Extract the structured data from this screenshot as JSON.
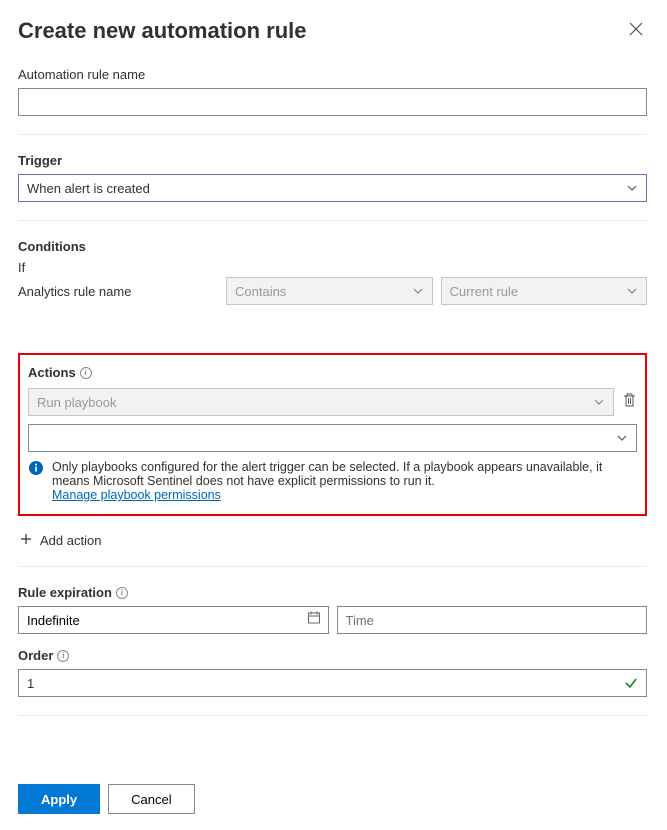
{
  "header": {
    "title": "Create new automation rule"
  },
  "rule_name": {
    "label": "Automation rule name",
    "value": ""
  },
  "trigger": {
    "label": "Trigger",
    "selected": "When alert is created"
  },
  "conditions": {
    "label": "Conditions",
    "if_text": "If",
    "field_label": "Analytics rule name",
    "operator": "Contains",
    "value": "Current rule"
  },
  "actions": {
    "label": "Actions",
    "action_type": "Run playbook",
    "playbook_selected": "",
    "info_text": "Only playbooks configured for the alert trigger can be selected. If a playbook appears unavailable, it means Microsoft Sentinel does not have explicit permissions to run it.",
    "manage_link": "Manage playbook permissions"
  },
  "add_action": "Add action",
  "expiration": {
    "label": "Rule expiration",
    "date": "Indefinite",
    "time_placeholder": "Time"
  },
  "order": {
    "label": "Order",
    "value": "1"
  },
  "footer": {
    "apply": "Apply",
    "cancel": "Cancel"
  }
}
